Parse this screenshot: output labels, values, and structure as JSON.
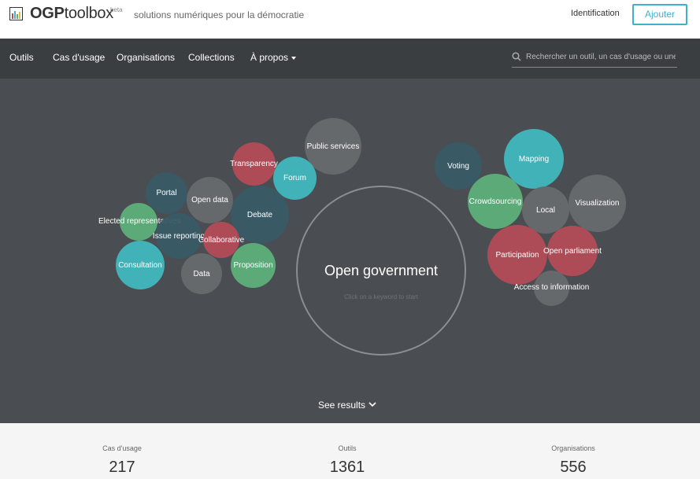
{
  "header": {
    "logo_prefix": "OGP",
    "logo_suffix": "toolbox",
    "beta": "beta",
    "tagline": "solutions numériques pour la démocratie",
    "identification": "Identification",
    "add_button": "Ajouter"
  },
  "nav": {
    "items": [
      "Outils",
      "Cas d'usage",
      "Organisations",
      "Collections",
      "À propos"
    ],
    "search_placeholder": "Rechercher un outil, un cas d'usage ou une"
  },
  "hero": {
    "center_title": "Open government",
    "center_subtitle": "Click on a keyword to start",
    "see_results": "See results",
    "keywords": [
      "Public services",
      "Transparency",
      "Forum",
      "Portal",
      "Open data",
      "Debate",
      "Elected representatives",
      "Issue reporting",
      "Collaborative",
      "Consultation",
      "Data",
      "Proposition",
      "Voting",
      "Mapping",
      "Crowdsourcing",
      "Local",
      "Visualization",
      "Participation",
      "Open parliament",
      "Access to information"
    ]
  },
  "stats": {
    "items": [
      {
        "label": "Cas d'usage",
        "value": "217"
      },
      {
        "label": "Outils",
        "value": "1361"
      },
      {
        "label": "Organisations",
        "value": "556"
      }
    ]
  },
  "colors": {
    "accent": "#3fb2c9",
    "navbar": "#3a3e41",
    "hero": "#4a4e52",
    "teal": "#40b7be",
    "red": "#b24c56",
    "grey": "#666a6e",
    "navy": "#385a66",
    "green": "#5daf7a"
  }
}
